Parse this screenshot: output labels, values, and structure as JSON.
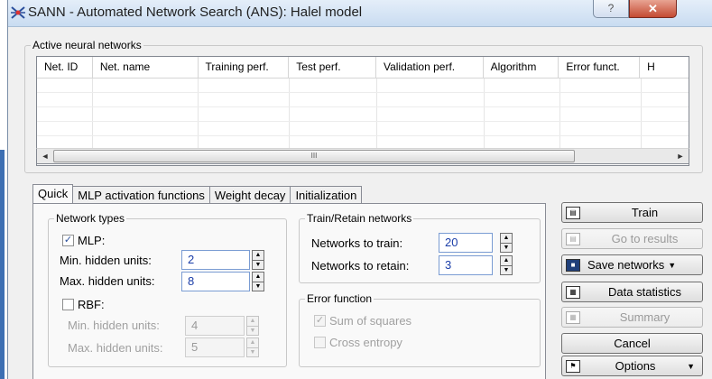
{
  "window": {
    "title": "SANN - Automated Network Search (ANS): Halel   model",
    "help_label": "?",
    "close_label": "✕"
  },
  "active_networks": {
    "label": "Active neural networks",
    "columns": [
      "Net. ID",
      "Net. name",
      "Training perf.",
      "Test perf.",
      "Validation perf.",
      "Algorithm",
      "Error funct.",
      "H"
    ],
    "scroll_grip": "III",
    "scroll_left": "◄",
    "scroll_right": "►"
  },
  "tabs": [
    {
      "label": "Quick",
      "active": true
    },
    {
      "label": "MLP activation functions",
      "active": false
    },
    {
      "label": "Weight decay",
      "active": false
    },
    {
      "label": "Initialization",
      "active": false
    }
  ],
  "network_types": {
    "label": "Network types",
    "mlp": {
      "label": "MLP:",
      "checked": true,
      "check_glyph": "✓"
    },
    "mlp_min": {
      "label": "Min. hidden units:",
      "value": "2"
    },
    "mlp_max": {
      "label": "Max. hidden units:",
      "value": "8"
    },
    "rbf": {
      "label": "RBF:",
      "checked": false
    },
    "rbf_min": {
      "label": "Min. hidden units:",
      "value": "4"
    },
    "rbf_max": {
      "label": "Max. hidden units:",
      "value": "5"
    }
  },
  "train_retain": {
    "label": "Train/Retain networks",
    "to_train": {
      "label": "Networks to train:",
      "value": "20"
    },
    "to_retain": {
      "label": "Networks to retain:",
      "value": "3"
    }
  },
  "error_function": {
    "label": "Error function",
    "sum_of_squares": {
      "label": "Sum of squares",
      "checked": true,
      "check_glyph": "✓"
    },
    "cross_entropy": {
      "label": "Cross entropy",
      "checked": false
    }
  },
  "actions": {
    "train": "Train",
    "go_to_results": "Go to results",
    "save_networks": "Save networks",
    "data_statistics": "Data statistics",
    "summary": "Summary",
    "cancel": "Cancel",
    "options": "Options"
  },
  "colors": {
    "value_text": "#1b3ea8",
    "close_button": "#c44a32",
    "title_bar": "#c9dcf1"
  }
}
